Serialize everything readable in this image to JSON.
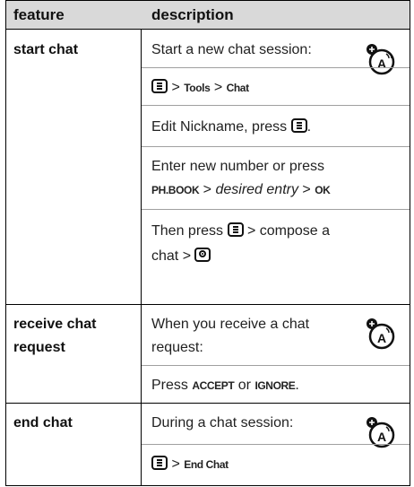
{
  "table": {
    "headers": {
      "feature": "feature",
      "description": "description"
    },
    "rows": [
      {
        "feature": "start chat",
        "lines": {
          "l1": "Start a new chat session:",
          "l2": {
            "sep1": ">",
            "tools": "Tools",
            "sep2": ">",
            "chat": "Chat"
          },
          "l3": {
            "text": "Edit Nickname, press",
            "end": "."
          },
          "l4": "Enter new number or press",
          "l5": {
            "phbook": "PH.BOOK",
            "sep1": ">",
            "entry": "desired entry",
            "sep2": ">",
            "ok": "OK"
          },
          "l6": {
            "pre": "Then press",
            "post": "> compose a"
          },
          "l7": {
            "pre": "chat >"
          }
        },
        "icon": "network-dependent-feature-icon"
      },
      {
        "feature_line1": "receive chat",
        "feature_line2": "request",
        "lines": {
          "l1": "When you receive a chat",
          "l2": "request:",
          "l3": {
            "pre": "Press",
            "accept": "ACCEPT",
            "or": "or",
            "ignore": "IGNORE",
            "end": "."
          }
        },
        "icon": "network-dependent-feature-icon"
      },
      {
        "feature": "end chat",
        "lines": {
          "l1": "During a chat session:",
          "l2": {
            "sep": ">",
            "endchat": "End Chat"
          }
        },
        "icon": "network-dependent-feature-icon"
      }
    ]
  },
  "colors": {
    "header_bg": "#d9d9d9",
    "border": "#000000",
    "separator": "#a0a0a0"
  }
}
